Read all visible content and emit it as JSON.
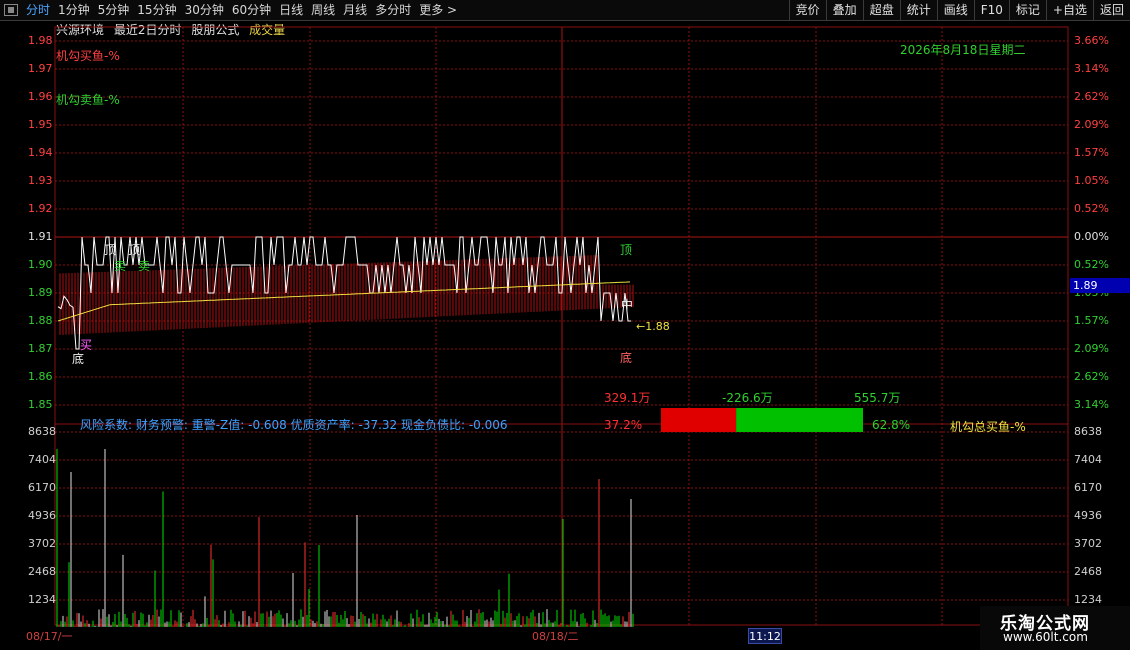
{
  "toolbar": {
    "tabs": [
      "分时",
      "1分钟",
      "5分钟",
      "15分钟",
      "30分钟",
      "60分钟",
      "日线",
      "周线",
      "月线",
      "多分时",
      "更多 >"
    ],
    "active_tab": 0,
    "right_buttons": [
      "竞价",
      "叠加",
      "超盘",
      "统计",
      "画线",
      "F10",
      "标记",
      "+自选",
      "返回"
    ]
  },
  "header": {
    "stock_name": "兴源环境",
    "mode": "最近2日分时",
    "formula": "股朋公式",
    "volume_label": "成交量"
  },
  "price_axis": {
    "left_ticks": [
      "1.98",
      "1.97",
      "1.96",
      "1.95",
      "1.94",
      "1.93",
      "1.92",
      "1.91",
      "1.90",
      "1.89",
      "1.88",
      "1.87",
      "1.86",
      "1.85"
    ],
    "right_ticks": [
      "3.66%",
      "3.14%",
      "2.62%",
      "2.09%",
      "1.57%",
      "1.05%",
      "0.52%",
      "0.00%",
      "0.52%",
      "1.05%",
      "1.57%",
      "2.09%",
      "2.62%",
      "3.14%"
    ],
    "reference_price": "1.91"
  },
  "volume_axis": {
    "ticks": [
      "8638",
      "7404",
      "6170",
      "4936",
      "3702",
      "2468",
      "1234"
    ]
  },
  "indicators": {
    "sell_legend": "机勾买鱼-%",
    "buy_legend": "机勾卖鱼-%",
    "date_text": "2026年8月18日星期二",
    "current_price": "1.89",
    "low_marker": "←1.88",
    "risk_text": "风险系数: 财务预警: 重警-Z值: -0.608 优质资产率: -37.32 现金负债比: -0.006",
    "flow_red_value": "329.1万",
    "flow_mid_value": "-226.6万",
    "flow_green_value": "555.7万",
    "flow_red_pct": "37.2%",
    "flow_green_pct": "62.8%",
    "flow_total_label": "机勾总买鱼-%",
    "flow_red_fraction": 0.372,
    "marks": {
      "top": "顶",
      "bottom": "底",
      "buy": "买",
      "sell": "卖",
      "mid": "中"
    }
  },
  "dates": {
    "day1": "08/17/一",
    "day2": "08/18/二",
    "cursor_time": "11:12"
  },
  "watermark": {
    "title": "乐淘公式网",
    "url": "www.60lt.com"
  },
  "colors": {
    "grid": "#8a1010",
    "up": "#ff3030",
    "down": "#00e000",
    "price_line": "#ffffff",
    "avg_line": "#f0e040",
    "axis_up": "#ff4040",
    "axis_down": "#30d030",
    "flow_red": "#e00000",
    "flow_green": "#00c000"
  }
}
